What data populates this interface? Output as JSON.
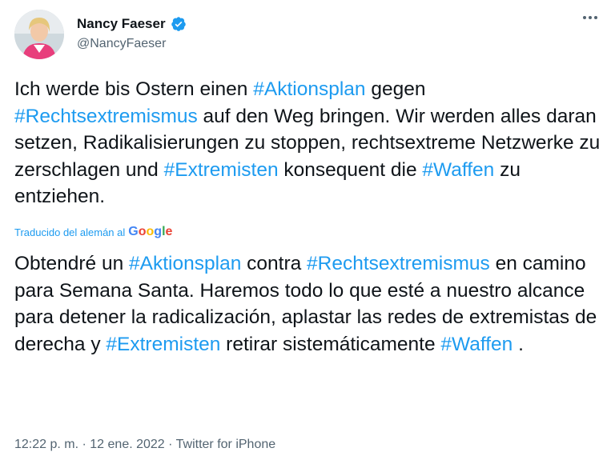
{
  "author": {
    "display_name": "Nancy Faeser",
    "handle": "@NancyFaeser",
    "verified_icon": "verified-badge-icon"
  },
  "tweet": {
    "original_segments": [
      {
        "text": "Ich werde bis Ostern einen ",
        "tag": false
      },
      {
        "text": "#Aktionsplan",
        "tag": true
      },
      {
        "text": " gegen ",
        "tag": false
      },
      {
        "text": "#Rechtsextremismus",
        "tag": true
      },
      {
        "text": " auf den Weg bringen. Wir werden alles daran setzen, Radikalisierungen zu stoppen, rechtsextreme Netzwerke zu zerschlagen und ",
        "tag": false
      },
      {
        "text": "#Extremisten",
        "tag": true
      },
      {
        "text": " konsequent die ",
        "tag": false
      },
      {
        "text": "#Waffen",
        "tag": true
      },
      {
        "text": " zu entziehen.",
        "tag": false
      }
    ],
    "translation_label": "Traducido del alemán al",
    "translation_provider": "Google",
    "translated_segments": [
      {
        "text": "Obtendré un ",
        "tag": false
      },
      {
        "text": "#Aktionsplan",
        "tag": true
      },
      {
        "text": " contra ",
        "tag": false
      },
      {
        "text": "#Rechtsextremismus",
        "tag": true
      },
      {
        "text": " en camino para Semana Santa. Haremos todo lo que esté a nuestro alcance para detener la radicalización, aplastar las redes de extremistas de derecha y ",
        "tag": false
      },
      {
        "text": "#Extremisten",
        "tag": true
      },
      {
        "text": " retirar sistemáticamente ",
        "tag": false
      },
      {
        "text": "#Waffen",
        "tag": true
      },
      {
        "text": " .",
        "tag": false
      }
    ]
  },
  "meta": {
    "time": "12:22 p. m.",
    "date": "12 ene. 2022",
    "source": "Twitter for iPhone",
    "separator": "·"
  },
  "colors": {
    "link": "#1d9bf0",
    "text": "#0f1419",
    "secondary": "#536471"
  }
}
